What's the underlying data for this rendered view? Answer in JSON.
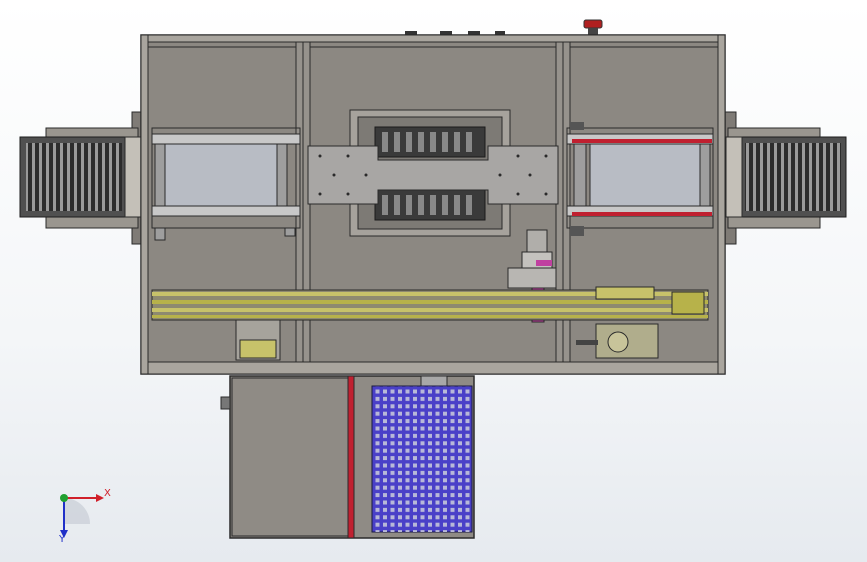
{
  "triad": {
    "x_label": "X",
    "y_label": "Y",
    "x_color": "#d0202a",
    "y_color": "#2030c8",
    "origin_color": "#20a030"
  },
  "colors": {
    "frame_fill": "#8f8b85",
    "frame_line": "#2a2a2a",
    "rail_yellow": "#b7b24a",
    "bin_blue": "#4a40c8",
    "accent_red": "#c02030",
    "accent_magenta": "#c040a0"
  }
}
